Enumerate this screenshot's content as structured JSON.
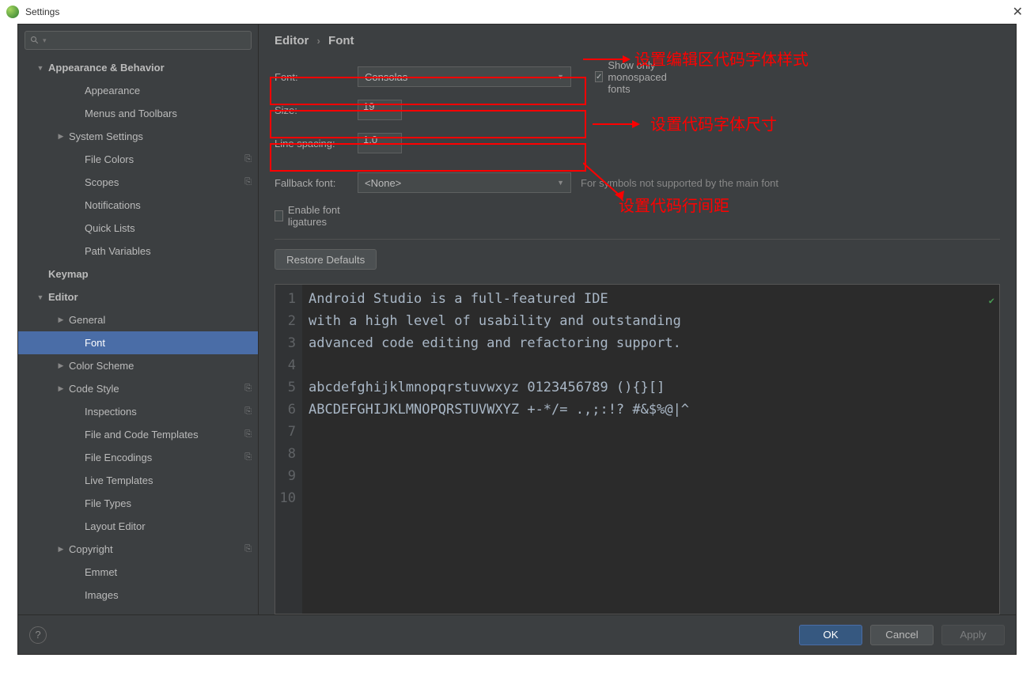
{
  "window": {
    "title": "Settings"
  },
  "search": {
    "placeholder": ""
  },
  "sidebar": {
    "items": [
      {
        "label": "Appearance & Behavior",
        "level": 0,
        "arrow": "down",
        "bold": true
      },
      {
        "label": "Appearance",
        "level": 2
      },
      {
        "label": "Menus and Toolbars",
        "level": 2
      },
      {
        "label": "System Settings",
        "level": 1,
        "arrow": "right"
      },
      {
        "label": "File Colors",
        "level": 2,
        "copy": true
      },
      {
        "label": "Scopes",
        "level": 2,
        "copy": true
      },
      {
        "label": "Notifications",
        "level": 2
      },
      {
        "label": "Quick Lists",
        "level": 2
      },
      {
        "label": "Path Variables",
        "level": 2
      },
      {
        "label": "Keymap",
        "level": 0,
        "bold": true
      },
      {
        "label": "Editor",
        "level": 0,
        "arrow": "down",
        "bold": true
      },
      {
        "label": "General",
        "level": 1,
        "arrow": "right"
      },
      {
        "label": "Font",
        "level": 2,
        "selected": true
      },
      {
        "label": "Color Scheme",
        "level": 1,
        "arrow": "right"
      },
      {
        "label": "Code Style",
        "level": 1,
        "arrow": "right",
        "copy": true
      },
      {
        "label": "Inspections",
        "level": 2,
        "copy": true
      },
      {
        "label": "File and Code Templates",
        "level": 2,
        "copy": true
      },
      {
        "label": "File Encodings",
        "level": 2,
        "copy": true
      },
      {
        "label": "Live Templates",
        "level": 2
      },
      {
        "label": "File Types",
        "level": 2
      },
      {
        "label": "Layout Editor",
        "level": 2
      },
      {
        "label": "Copyright",
        "level": 1,
        "arrow": "right",
        "copy": true
      },
      {
        "label": "Emmet",
        "level": 2
      },
      {
        "label": "Images",
        "level": 2
      }
    ]
  },
  "breadcrumb": {
    "root": "Editor",
    "leaf": "Font"
  },
  "form": {
    "font_label": "Font:",
    "font_value": "Consolas",
    "show_mono_label": "Show only monospaced fonts",
    "show_mono_checked": true,
    "size_label": "Size:",
    "size_value": "19",
    "spacing_label": "Line spacing:",
    "spacing_value": "1.0",
    "fallback_label": "Fallback font:",
    "fallback_value": "<None>",
    "fallback_hint": "For symbols not supported by the main font",
    "ligatures_label": "Enable font ligatures",
    "ligatures_checked": false,
    "restore_label": "Restore Defaults"
  },
  "editor": {
    "lines": [
      "Android Studio is a full-featured IDE",
      "with a high level of usability and outstanding",
      "advanced code editing and refactoring support.",
      "",
      "abcdefghijklmnopqrstuvwxyz 0123456789 (){}[]",
      "ABCDEFGHIJKLMNOPQRSTUVWXYZ +-*/= .,;:!? #&$%@|^",
      "",
      "",
      "",
      ""
    ]
  },
  "annotations": {
    "a1": "设置编辑区代码字体样式",
    "a2": "设置代码字体尺寸",
    "a3": "设置代码行间距"
  },
  "footer": {
    "ok": "OK",
    "cancel": "Cancel",
    "apply": "Apply"
  }
}
